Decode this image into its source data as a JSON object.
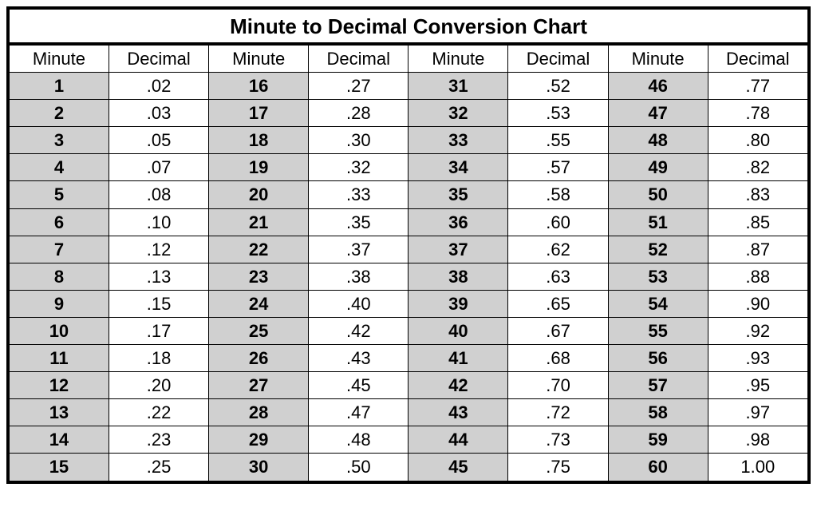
{
  "title": "Minute to Decimal Conversion Chart",
  "headers": {
    "minute": "Minute",
    "decimal": "Decimal"
  },
  "columns": 4,
  "rows_per_column": 15,
  "chart_data": {
    "type": "table",
    "title": "Minute to Decimal Conversion Chart",
    "column_headers": [
      "Minute",
      "Decimal"
    ],
    "entries": [
      {
        "minute": 1,
        "decimal": ".02"
      },
      {
        "minute": 2,
        "decimal": ".03"
      },
      {
        "minute": 3,
        "decimal": ".05"
      },
      {
        "minute": 4,
        "decimal": ".07"
      },
      {
        "minute": 5,
        "decimal": ".08"
      },
      {
        "minute": 6,
        "decimal": ".10"
      },
      {
        "minute": 7,
        "decimal": ".12"
      },
      {
        "minute": 8,
        "decimal": ".13"
      },
      {
        "minute": 9,
        "decimal": ".15"
      },
      {
        "minute": 10,
        "decimal": ".17"
      },
      {
        "minute": 11,
        "decimal": ".18"
      },
      {
        "minute": 12,
        "decimal": ".20"
      },
      {
        "minute": 13,
        "decimal": ".22"
      },
      {
        "minute": 14,
        "decimal": ".23"
      },
      {
        "minute": 15,
        "decimal": ".25"
      },
      {
        "minute": 16,
        "decimal": ".27"
      },
      {
        "minute": 17,
        "decimal": ".28"
      },
      {
        "minute": 18,
        "decimal": ".30"
      },
      {
        "minute": 19,
        "decimal": ".32"
      },
      {
        "minute": 20,
        "decimal": ".33"
      },
      {
        "minute": 21,
        "decimal": ".35"
      },
      {
        "minute": 22,
        "decimal": ".37"
      },
      {
        "minute": 23,
        "decimal": ".38"
      },
      {
        "minute": 24,
        "decimal": ".40"
      },
      {
        "minute": 25,
        "decimal": ".42"
      },
      {
        "minute": 26,
        "decimal": ".43"
      },
      {
        "minute": 27,
        "decimal": ".45"
      },
      {
        "minute": 28,
        "decimal": ".47"
      },
      {
        "minute": 29,
        "decimal": ".48"
      },
      {
        "minute": 30,
        "decimal": ".50"
      },
      {
        "minute": 31,
        "decimal": ".52"
      },
      {
        "minute": 32,
        "decimal": ".53"
      },
      {
        "minute": 33,
        "decimal": ".55"
      },
      {
        "minute": 34,
        "decimal": ".57"
      },
      {
        "minute": 35,
        "decimal": ".58"
      },
      {
        "minute": 36,
        "decimal": ".60"
      },
      {
        "minute": 37,
        "decimal": ".62"
      },
      {
        "minute": 38,
        "decimal": ".63"
      },
      {
        "minute": 39,
        "decimal": ".65"
      },
      {
        "minute": 40,
        "decimal": ".67"
      },
      {
        "minute": 41,
        "decimal": ".68"
      },
      {
        "minute": 42,
        "decimal": ".70"
      },
      {
        "minute": 43,
        "decimal": ".72"
      },
      {
        "minute": 44,
        "decimal": ".73"
      },
      {
        "minute": 45,
        "decimal": ".75"
      },
      {
        "minute": 46,
        "decimal": ".77"
      },
      {
        "minute": 47,
        "decimal": ".78"
      },
      {
        "minute": 48,
        "decimal": ".80"
      },
      {
        "minute": 49,
        "decimal": ".82"
      },
      {
        "minute": 50,
        "decimal": ".83"
      },
      {
        "minute": 51,
        "decimal": ".85"
      },
      {
        "minute": 52,
        "decimal": ".87"
      },
      {
        "minute": 53,
        "decimal": ".88"
      },
      {
        "minute": 54,
        "decimal": ".90"
      },
      {
        "minute": 55,
        "decimal": ".92"
      },
      {
        "minute": 56,
        "decimal": ".93"
      },
      {
        "minute": 57,
        "decimal": ".95"
      },
      {
        "minute": 58,
        "decimal": ".97"
      },
      {
        "minute": 59,
        "decimal": ".98"
      },
      {
        "minute": 60,
        "decimal": "1.00"
      }
    ]
  }
}
